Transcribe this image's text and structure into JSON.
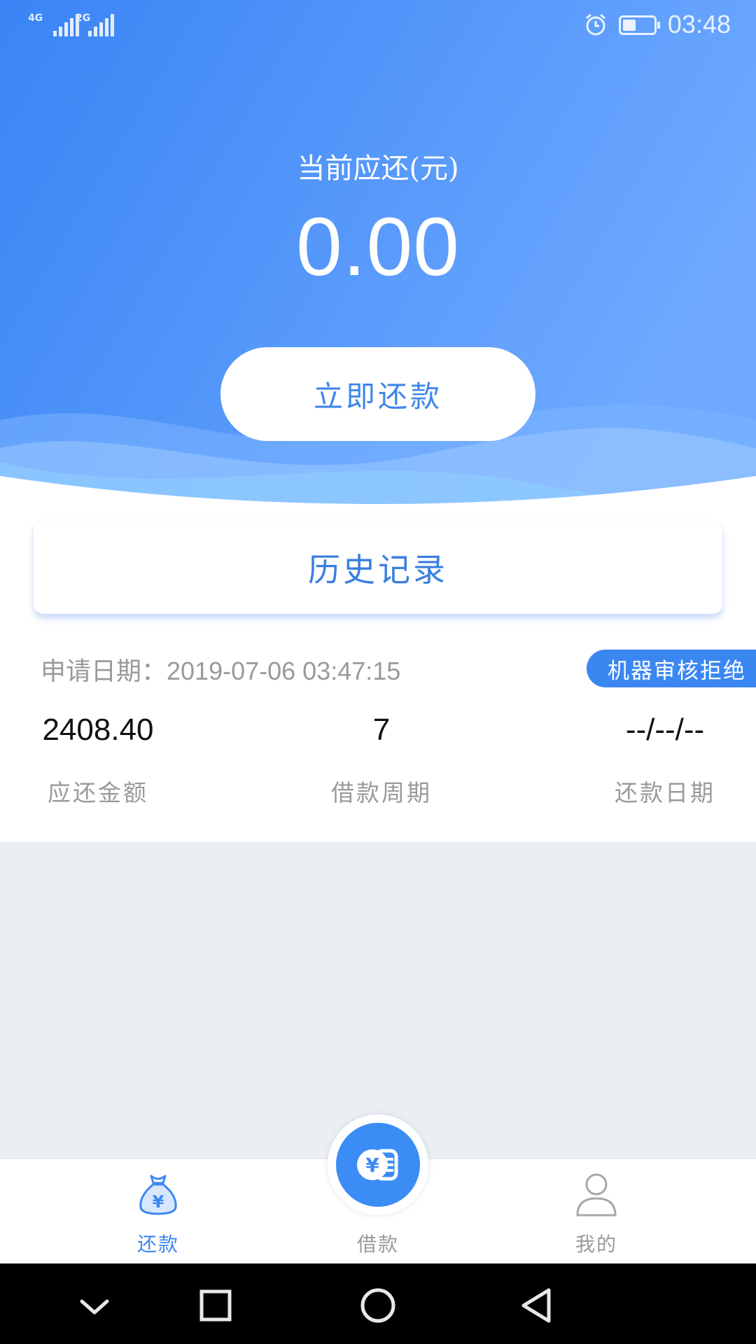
{
  "status_bar": {
    "signal_1_label": "4G",
    "signal_2_label": "2G",
    "time": "03:48"
  },
  "header": {
    "title": "当前应还(元)",
    "amount": "0.00",
    "repay_button": "立即还款"
  },
  "history": {
    "label": "历史记录"
  },
  "record": {
    "apply_date_label": "申请日期：",
    "apply_date_value": "2019-07-06 03:47:15",
    "status": "机器审核拒绝",
    "amount_due": {
      "value": "2408.40",
      "label": "应还金额"
    },
    "loan_period": {
      "value": "7",
      "label": "借款周期"
    },
    "repay_date": {
      "value": "--/--/--",
      "label": "还款日期"
    }
  },
  "tabbar": {
    "tabs": [
      {
        "label": "还款",
        "icon": "money-bag-icon",
        "active": true
      },
      {
        "label": "借款",
        "icon": "yen-coin-icon",
        "active": false
      },
      {
        "label": "我的",
        "icon": "user-icon",
        "active": false
      }
    ],
    "active_color": "#3b87f2",
    "inactive_color": "#9a9a9a"
  },
  "navbar": {
    "icons": [
      "chevron-down-icon",
      "square-icon",
      "circle-home-icon",
      "back-triangle-icon"
    ]
  },
  "colors": {
    "brand_blue": "#3b87f2",
    "header_gradient_start": "#3c86f4",
    "header_gradient_end": "#6aa6ff",
    "background": "#eceff2"
  }
}
